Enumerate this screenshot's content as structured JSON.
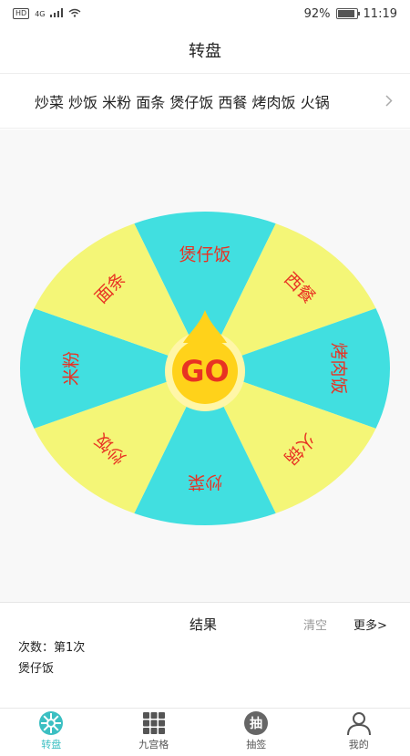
{
  "status_bar": {
    "network_badge": "HD",
    "network_type": "4G",
    "battery_percent": "92%",
    "battery_level": 0.92,
    "time": "11:19"
  },
  "title": "转盘",
  "categories": {
    "text": "炒菜 炒饭 米粉 面条 煲仔饭 西餐 烤肉饭 火锅",
    "items": [
      "炒菜",
      "炒饭",
      "米粉",
      "面条",
      "煲仔饭",
      "西餐",
      "烤肉饭",
      "火锅"
    ]
  },
  "wheel": {
    "segments": [
      "煲仔饭",
      "西餐",
      "烤肉饭",
      "火锅",
      "炒菜",
      "炒饭",
      "米粉",
      "面条"
    ],
    "go_label": "GO",
    "colors": {
      "cyan": "#41dfe0",
      "yellow": "#f4f677",
      "text": "#e83223",
      "go_fill": "#ffd21a",
      "go_ring": "#fff6a8"
    }
  },
  "result": {
    "title": "结果",
    "clear_label": "清空",
    "more_label": "更多>",
    "count_line": "次数：第1次",
    "value": "煲仔饭"
  },
  "tabs": [
    {
      "label": "转盘",
      "icon": "wheel-icon",
      "active": true
    },
    {
      "label": "九宫格",
      "icon": "grid-icon",
      "active": false
    },
    {
      "label": "抽签",
      "icon": "draw-icon",
      "active": false,
      "glyph": "抽"
    },
    {
      "label": "我的",
      "icon": "person-icon",
      "active": false
    }
  ],
  "accent_color": "#3bbfc2"
}
